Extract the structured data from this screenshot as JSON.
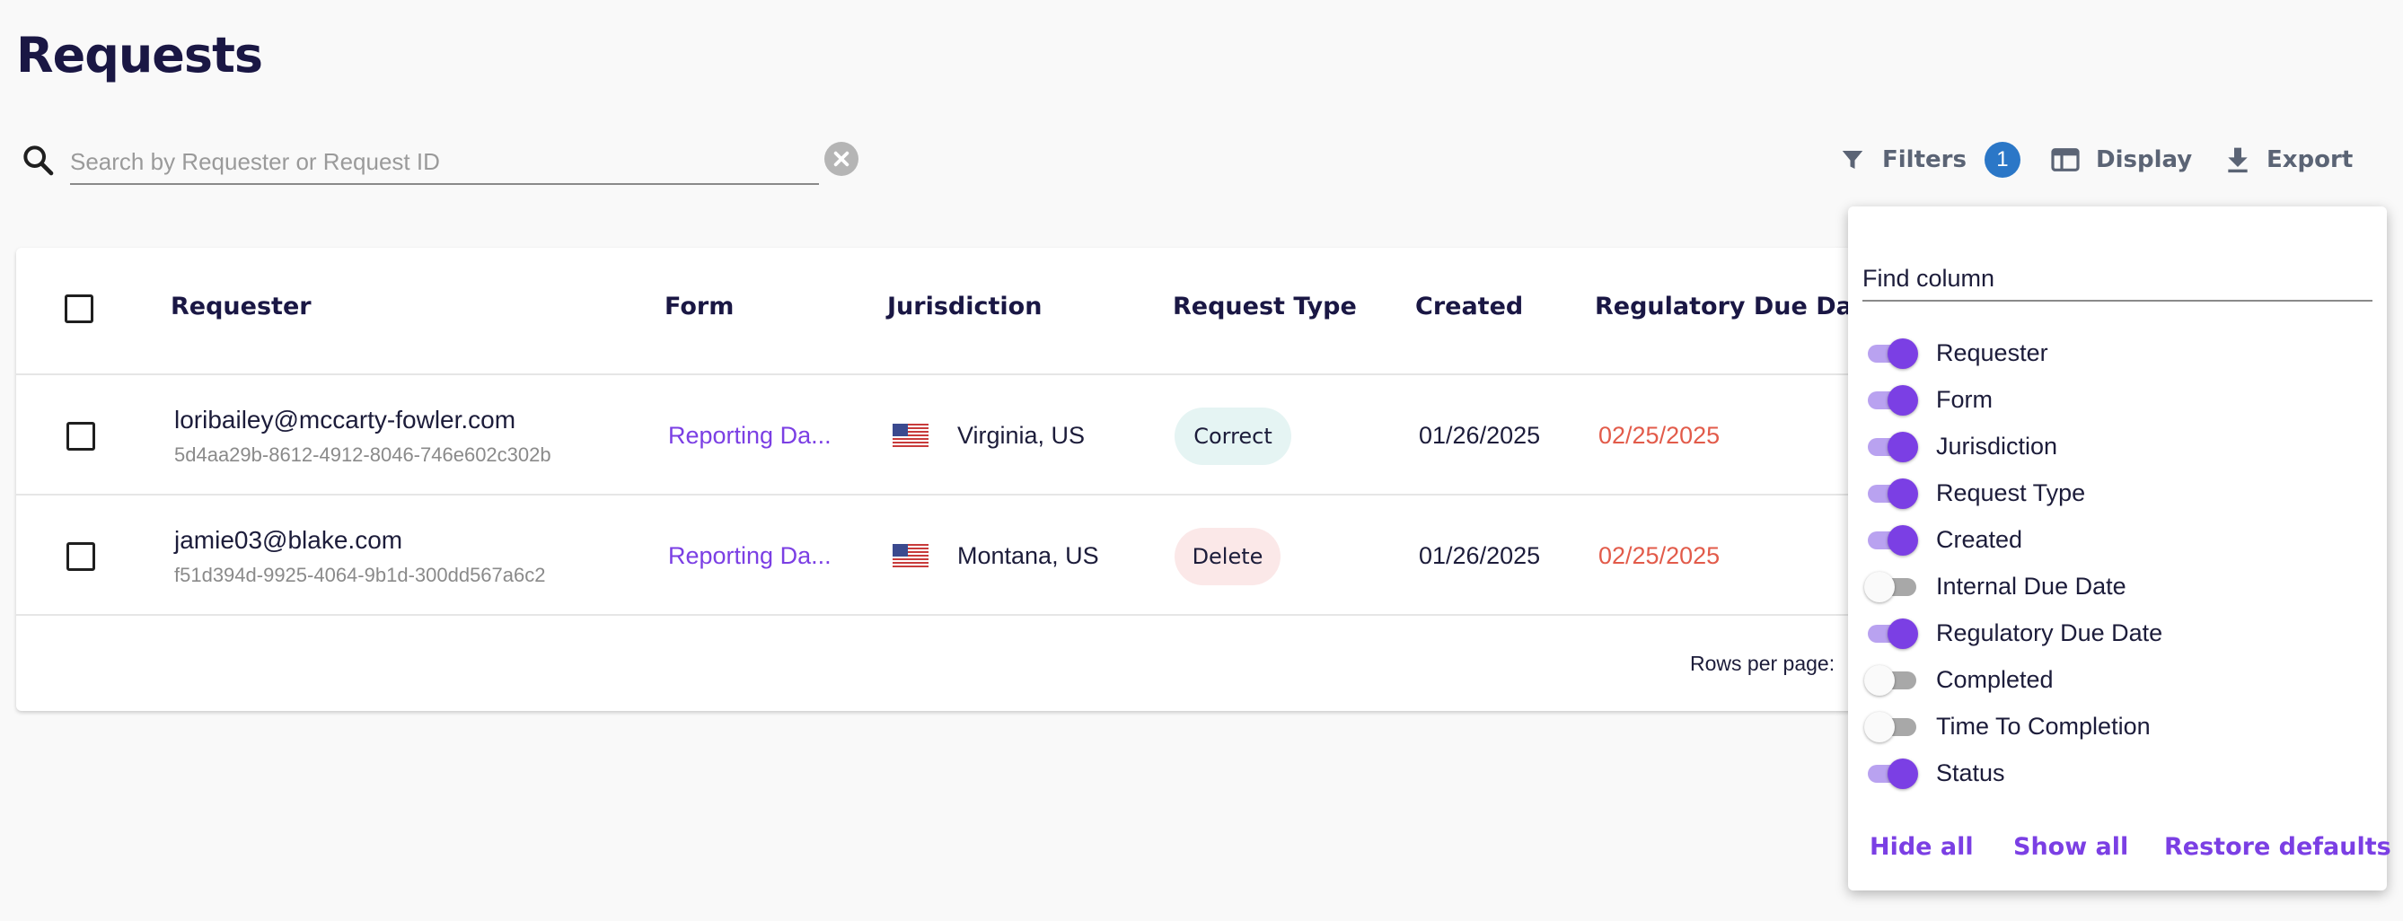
{
  "page": {
    "title": "Requests"
  },
  "search": {
    "placeholder": "Search by Requester or Request ID",
    "value": ""
  },
  "toolbar": {
    "filters_label": "Filters",
    "filters_count": "1",
    "display_label": "Display",
    "export_label": "Export"
  },
  "table": {
    "columns": {
      "requester": "Requester",
      "form": "Form",
      "jurisdiction": "Jurisdiction",
      "request_type": "Request Type",
      "created": "Created",
      "regulatory_due_date": "Regulatory Due Date"
    },
    "rows": [
      {
        "email": "loribailey@mccarty-fowler.com",
        "request_id": "5d4aa29b-8612-4912-8046-746e602c302b",
        "form": "Reporting Da...",
        "jurisdiction": "Virginia, US",
        "request_type": "Correct",
        "created": "01/26/2025",
        "due": "02/25/2025"
      },
      {
        "email": "jamie03@blake.com",
        "request_id": "f51d394d-9925-4064-9b1d-300dd567a6c2",
        "form": "Reporting Da...",
        "jurisdiction": "Montana, US",
        "request_type": "Delete",
        "created": "01/26/2025",
        "due": "02/25/2025"
      }
    ],
    "pagination": {
      "rows_per_page_label": "Rows per page:"
    }
  },
  "column_panel": {
    "find_placeholder": "Find column",
    "items": [
      {
        "label": "Requester",
        "enabled": true
      },
      {
        "label": "Form",
        "enabled": true
      },
      {
        "label": "Jurisdiction",
        "enabled": true
      },
      {
        "label": "Request Type",
        "enabled": true
      },
      {
        "label": "Created",
        "enabled": true
      },
      {
        "label": "Internal Due Date",
        "enabled": false
      },
      {
        "label": "Regulatory Due Date",
        "enabled": true
      },
      {
        "label": "Completed",
        "enabled": false
      },
      {
        "label": "Time To Completion",
        "enabled": false
      },
      {
        "label": "Status",
        "enabled": true
      }
    ],
    "hide_all": "Hide all",
    "show_all": "Show all",
    "restore_defaults": "Restore defaults"
  },
  "colors": {
    "accent": "#7b3fe4",
    "badge": "#2b77c7",
    "due_date": "#e25b4a",
    "title": "#1a1744"
  }
}
